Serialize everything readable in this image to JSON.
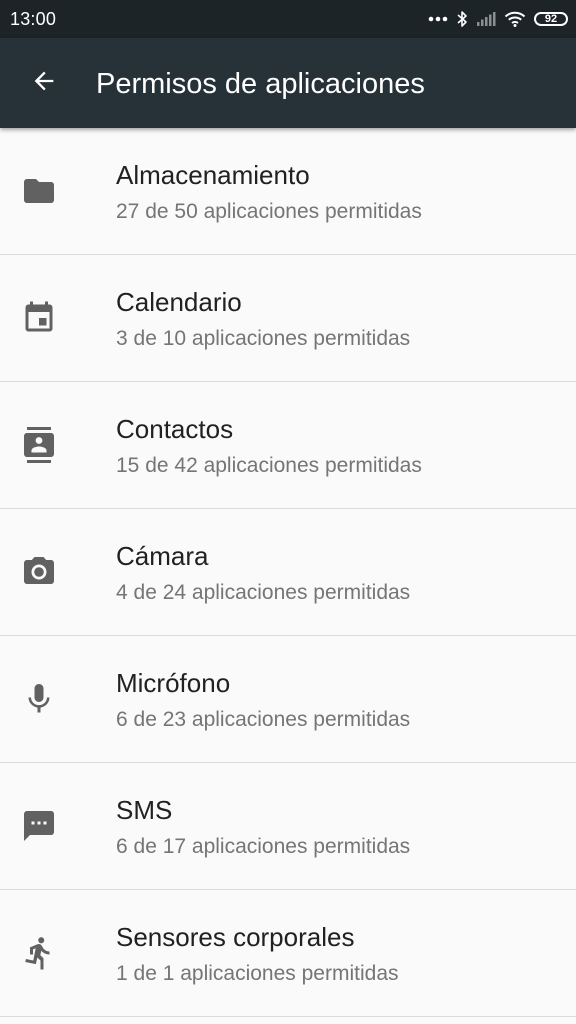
{
  "status_bar": {
    "time": "13:00",
    "battery": "92",
    "icons": [
      "more-dots-icon",
      "bluetooth-icon",
      "signal-icon",
      "wifi-icon",
      "battery-icon"
    ]
  },
  "app_bar": {
    "title": "Permisos de aplicaciones",
    "back_icon": "arrow-back-icon",
    "background": "#263238"
  },
  "permissions": [
    {
      "icon": "folder-icon",
      "title": "Almacenamiento",
      "subtitle": "27 de 50 aplicaciones permitidas"
    },
    {
      "icon": "calendar-icon",
      "title": "Calendario",
      "subtitle": "3 de 10 aplicaciones permitidas"
    },
    {
      "icon": "contacts-icon",
      "title": "Contactos",
      "subtitle": "15 de 42 aplicaciones permitidas"
    },
    {
      "icon": "camera-icon",
      "title": "Cámara",
      "subtitle": "4 de 24 aplicaciones permitidas"
    },
    {
      "icon": "microphone-icon",
      "title": "Micrófono",
      "subtitle": "6 de 23 aplicaciones permitidas"
    },
    {
      "icon": "sms-icon",
      "title": "SMS",
      "subtitle": "6 de 17 aplicaciones permitidas"
    },
    {
      "icon": "body-sensors-icon",
      "title": "Sensores corporales",
      "subtitle": "1 de 1 aplicaciones permitidas"
    }
  ],
  "colors": {
    "title_text": "#212121",
    "subtitle_text": "#757575",
    "icon": "#616161",
    "divider": "#dcdcdc"
  }
}
